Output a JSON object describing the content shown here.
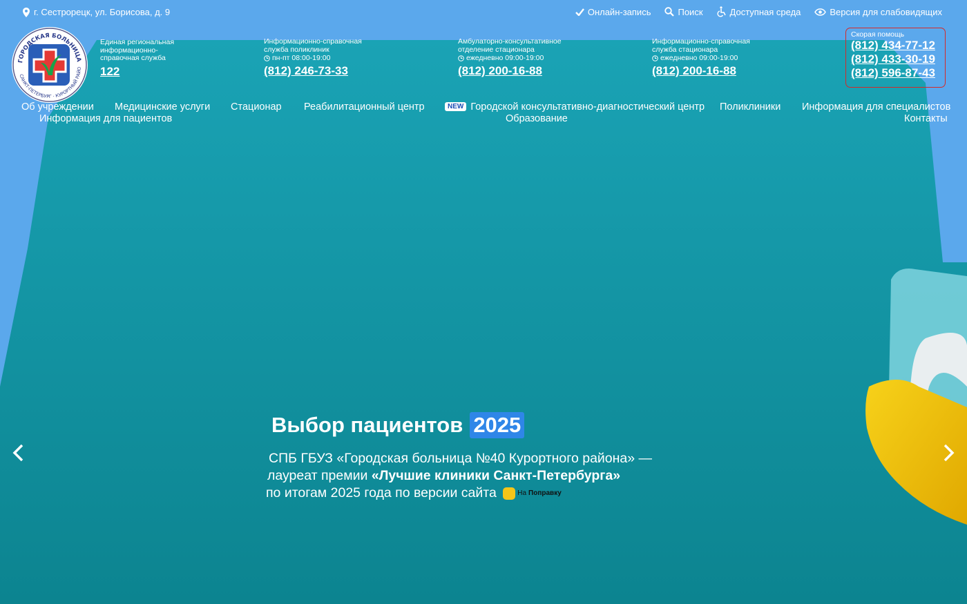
{
  "colors": {
    "sky": "#5ba8ec",
    "teal_top": "#189fb3",
    "teal_bottom": "#0d8794",
    "emergency_border": "#d62828",
    "year_badge": "#2f86e8"
  },
  "topbar": {
    "address": "г. Сестрорецк, ул. Борисова, д. 9",
    "links": [
      {
        "label": "Онлайн-запись",
        "icon": "check-icon"
      },
      {
        "label": "Поиск",
        "icon": "search-icon"
      },
      {
        "label": "Доступная среда",
        "icon": "wheelchair-icon"
      },
      {
        "label": "Версия для слабовидящих",
        "icon": "eye-icon"
      }
    ]
  },
  "logo": {
    "text_top": "ГОРОДСКАЯ БОЛЬНИЦА №40",
    "text_bottom": "САНКТ-ПЕТЕРБУРГ · КУРОРТНЫЙ РАЙОН"
  },
  "contacts": [
    {
      "label": "Единая региональная\nинформационно-\nсправочная служба",
      "hours": "",
      "phone": "122"
    },
    {
      "label": "Информационно-справочная\nслужба поликлиник",
      "hours": "пн-пт 08:00-19:00",
      "phone": "(812) 246-73-33"
    },
    {
      "label": "Амбулаторно-консультативное\nотделение стационара",
      "hours": "ежедневно 09:00-19:00",
      "phone": "(812) 200-16-88"
    },
    {
      "label": "Информационно-справочная\nслужба стационара",
      "hours": "ежедневно 09:00-19:00",
      "phone": "(812) 200-16-88"
    }
  ],
  "emergency": {
    "label": "Скорая помощь",
    "phones": [
      "(812) 434-77-12",
      "(812) 433-30-19",
      "(812) 596-87-43"
    ]
  },
  "nav": {
    "about": "Об учреждении",
    "services": "Медицинские услуги",
    "hospital": "Стационар",
    "rehab": "Реабилитационный центр",
    "new_badge": "NEW",
    "diagnostic": "Городской консультативно-диагностический центр",
    "clinics": "Поликлиники",
    "specialists": "Информация для специалистов",
    "patients": "Информация для пациентов",
    "education": "Образование",
    "contacts": "Контакты"
  },
  "slide": {
    "title": "Выбор пациентов",
    "year": "2025",
    "line1": "СПБ ГБУЗ «Городская больница №40 Курортного района» —",
    "line2_prefix": "лауреат премии ",
    "line2_bold": "«Лучшие клиники Санкт-Петербурга»",
    "line3": "по итогам 2025 года по версии сайта",
    "brand_na": "На",
    "brand_name": "Поправку"
  }
}
